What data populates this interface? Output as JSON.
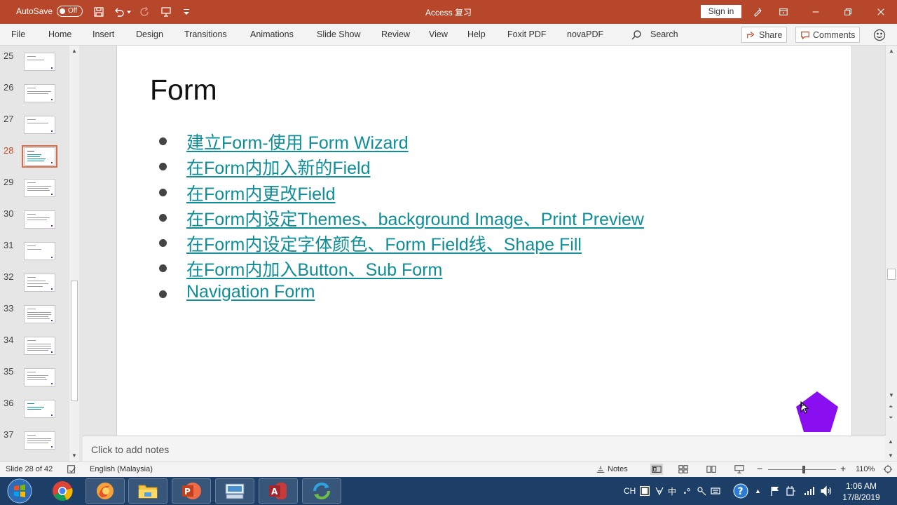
{
  "titlebar": {
    "autosave_label": "AutoSave",
    "autosave_state": "Off",
    "document_title": "Access 复习",
    "sign_in": "Sign in",
    "bg_color": "#b7472a"
  },
  "menu": {
    "items": [
      "File",
      "Home",
      "Insert",
      "Design",
      "Transitions",
      "Animations",
      "Slide Show",
      "Review",
      "View",
      "Help",
      "Foxit PDF",
      "novaPDF"
    ],
    "search_label": "Search",
    "share_label": "Share",
    "comments_label": "Comments"
  },
  "thumbnails": {
    "numbers": [
      "25",
      "26",
      "27",
      "28",
      "29",
      "30",
      "31",
      "32",
      "33",
      "34",
      "35",
      "36",
      "37"
    ],
    "selected": "28"
  },
  "slide": {
    "title": "Form",
    "bullets": [
      "建立Form-使用 Form Wizard",
      "在Form内加入新的Field",
      "在Form内更改Field",
      "在Form内设定Themes、background Image、Print Preview",
      "在Form内设定字体颜色、Form Field线、Shape Fill",
      "在Form内加入Button、Sub Form",
      "Navigation Form"
    ],
    "link_color": "#0f8e98",
    "shape_color": "#8a0ff0"
  },
  "notes": {
    "placeholder": "Click to add notes"
  },
  "status": {
    "slide_info": "Slide 28 of 42",
    "language": "English (Malaysia)",
    "notes_label": "Notes",
    "zoom": "110%"
  },
  "taskbar": {
    "apps": [
      "chrome-icon",
      "firefox-icon",
      "file-explorer-icon",
      "powerpoint-icon",
      "keyboard-app-icon",
      "access-icon",
      "sync-app-icon"
    ],
    "lang": "CH",
    "ime": "中",
    "time": "1:06 AM",
    "date": "17/8/2019"
  }
}
